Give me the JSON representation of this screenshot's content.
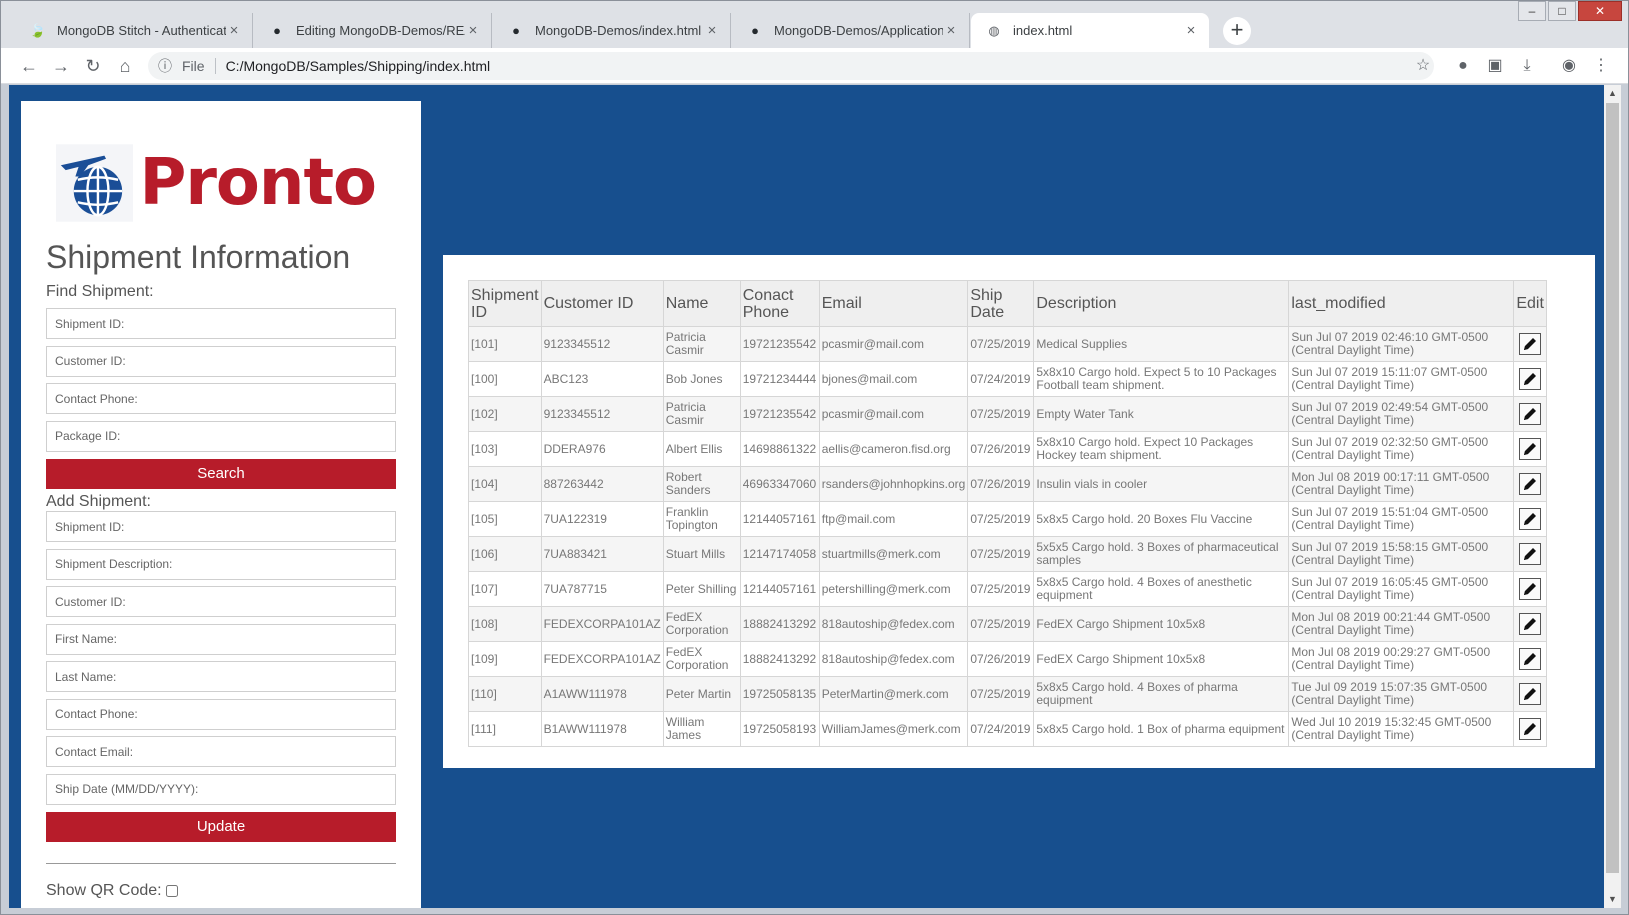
{
  "browser": {
    "tabs": [
      {
        "title": "MongoDB Stitch - Authentication",
        "icon": "leaf-icon"
      },
      {
        "title": "Editing MongoDB-Demos/README",
        "icon": "github-icon"
      },
      {
        "title": "MongoDB-Demos/index.html at",
        "icon": "github-icon"
      },
      {
        "title": "MongoDB-Demos/Applications/S",
        "icon": "github-icon"
      },
      {
        "title": "index.html",
        "icon": "globe-icon",
        "active": true
      }
    ],
    "new_tab": "+",
    "address": {
      "scheme_label": "File",
      "url": "C:/MongoDB/Samples/Shipping/index.html"
    },
    "window_buttons": {
      "minimize": "–",
      "maximize": "□",
      "close": "✕"
    }
  },
  "app": {
    "brand": "Pronto",
    "brand_color": "#b71c2a",
    "background_color": "#174f8e",
    "heading": "Shipment Information",
    "find": {
      "label": "Find Shipment:",
      "fields": [
        "Shipment ID:",
        "Customer ID:",
        "Contact Phone:",
        "Package ID:"
      ],
      "button": "Search"
    },
    "add": {
      "label": "Add Shipment:",
      "fields": [
        "Shipment ID:",
        "Shipment Description:",
        "Customer ID:",
        "First Name:",
        "Last Name:",
        "Contact Phone:",
        "Contact Email:",
        "Ship Date (MM/DD/YYYY):"
      ],
      "button": "Update"
    },
    "qr_label": "Show QR Code:"
  },
  "table": {
    "headers": [
      "Shipment ID",
      "Customer ID",
      "Name",
      "Conact Phone",
      "Email",
      "Ship Date",
      "Description",
      "last_modified",
      "Edit"
    ],
    "rows": [
      [
        "[101]",
        "9123345512",
        "Patricia Casmir",
        "19721235542",
        "pcasmir@mail.com",
        "07/25/2019",
        "Medical Supplies",
        "Sun Jul 07 2019 02:46:10 GMT-0500 (Central Daylight Time)"
      ],
      [
        "[100]",
        "ABC123",
        "Bob Jones",
        "19721234444",
        "bjones@mail.com",
        "07/24/2019",
        "5x8x10 Cargo hold. Expect 5 to 10 Packages Football team shipment.",
        "Sun Jul 07 2019 15:11:07 GMT-0500 (Central Daylight Time)"
      ],
      [
        "[102]",
        "9123345512",
        "Patricia Casmir",
        "19721235542",
        "pcasmir@mail.com",
        "07/25/2019",
        "Empty Water Tank",
        "Sun Jul 07 2019 02:49:54 GMT-0500 (Central Daylight Time)"
      ],
      [
        "[103]",
        "DDERA976",
        "Albert Ellis",
        "14698861322",
        "aellis@cameron.fisd.org",
        "07/26/2019",
        "5x8x10 Cargo hold. Expect 10 Packages Hockey team shipment.",
        "Sun Jul 07 2019 02:32:50 GMT-0500 (Central Daylight Time)"
      ],
      [
        "[104]",
        "887263442",
        "Robert Sanders",
        "46963347060",
        "rsanders@johnhopkins.org",
        "07/26/2019",
        "Insulin vials in cooler",
        "Mon Jul 08 2019 00:17:11 GMT-0500 (Central Daylight Time)"
      ],
      [
        "[105]",
        "7UA122319",
        "Franklin Topington",
        "12144057161",
        "ftp@mail.com",
        "07/25/2019",
        "5x8x5 Cargo hold. 20 Boxes Flu Vaccine",
        "Sun Jul 07 2019 15:51:04 GMT-0500 (Central Daylight Time)"
      ],
      [
        "[106]",
        "7UA883421",
        "Stuart Mills",
        "12147174058",
        "stuartmills@merk.com",
        "07/25/2019",
        "5x5x5 Cargo hold. 3 Boxes of pharmaceutical samples",
        "Sun Jul 07 2019 15:58:15 GMT-0500 (Central Daylight Time)"
      ],
      [
        "[107]",
        "7UA787715",
        "Peter Shilling",
        "12144057161",
        "petershilling@merk.com",
        "07/25/2019",
        "5x8x5 Cargo hold. 4 Boxes of anesthetic equipment",
        "Sun Jul 07 2019 16:05:45 GMT-0500 (Central Daylight Time)"
      ],
      [
        "[108]",
        "FEDEXCORPA101AZ",
        "FedEX Corporation",
        "18882413292",
        "818autoship@fedex.com",
        "07/25/2019",
        "FedEX Cargo Shipment 10x5x8",
        "Mon Jul 08 2019 00:21:44 GMT-0500 (Central Daylight Time)"
      ],
      [
        "[109]",
        "FEDEXCORPA101AZ",
        "FedEX Corporation",
        "18882413292",
        "818autoship@fedex.com",
        "07/26/2019",
        "FedEX Cargo Shipment 10x5x8",
        "Mon Jul 08 2019 00:29:27 GMT-0500 (Central Daylight Time)"
      ],
      [
        "[110]",
        "A1AWW111978",
        "Peter Martin",
        "19725058135",
        "PeterMartin@merk.com",
        "07/25/2019",
        "5x8x5 Cargo hold. 4 Boxes of pharma equipment",
        "Tue Jul 09 2019 15:07:35 GMT-0500 (Central Daylight Time)"
      ],
      [
        "[111]",
        "B1AWW111978",
        "William James",
        "19725058193",
        "WilliamJames@merk.com",
        "07/24/2019",
        "5x8x5 Cargo hold. 1 Box of pharma equipment",
        "Wed Jul 10 2019 15:32:45 GMT-0500 (Central Daylight Time)"
      ]
    ]
  }
}
